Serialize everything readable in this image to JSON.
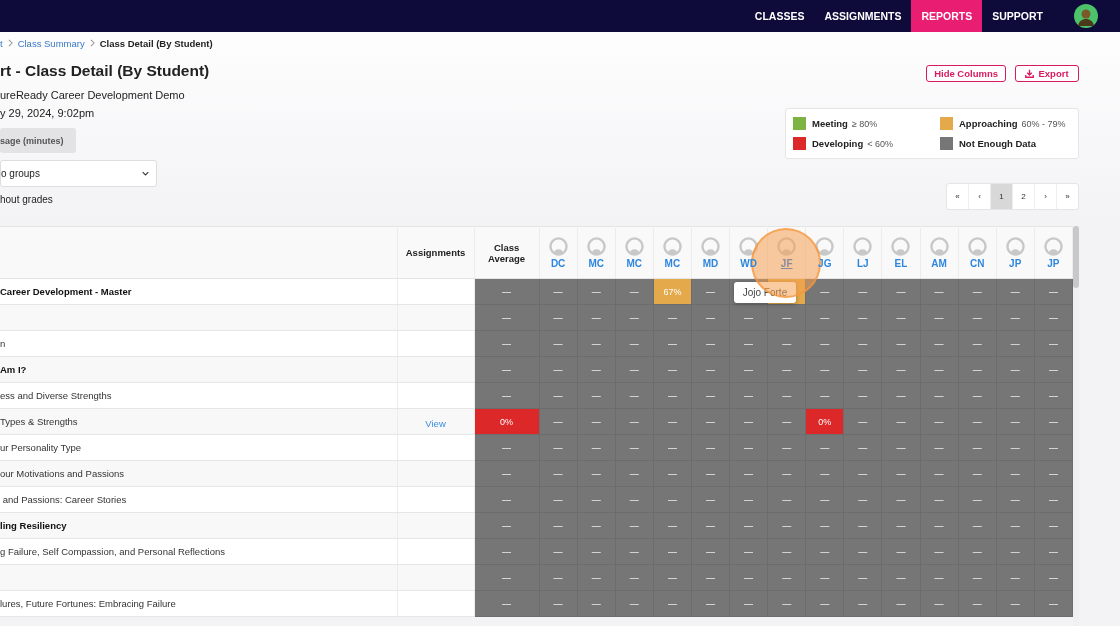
{
  "nav": {
    "items": [
      {
        "label": "CLASSES",
        "selected": false
      },
      {
        "label": "ASSIGNMENTS",
        "selected": false
      },
      {
        "label": "REPORTS",
        "selected": true
      },
      {
        "label": "SUPPORT",
        "selected": false
      }
    ]
  },
  "breadcrumb": [
    {
      "label": "t",
      "current": false
    },
    {
      "label": "Class Summary",
      "current": false
    },
    {
      "label": "Class Detail (By Student)",
      "current": true
    }
  ],
  "title": "rt - Class Detail (By Student)",
  "subtitle_lines": [
    "ureReady Career Development Demo",
    "y 29, 2024, 9:02pm"
  ],
  "usage_button": "sage (minutes)",
  "group_select": {
    "value": "o groups"
  },
  "grades_note": "hout grades",
  "actions": [
    {
      "label": "Hide Columns",
      "kind": "plain"
    },
    {
      "label": "Export",
      "kind": "download"
    }
  ],
  "legend": [
    {
      "label": "Meeting",
      "range": "≥ 80%",
      "color": "#7cb342"
    },
    {
      "label": "Approaching",
      "range": "60% - 79%",
      "color": "#e3a94b"
    },
    {
      "label": "Developing",
      "range": "< 60%",
      "color": "#dc2828"
    },
    {
      "label": "Not Enough Data",
      "color": "#767676"
    }
  ],
  "pagination": [
    {
      "label": "«",
      "selected": false
    },
    {
      "label": "‹",
      "selected": false
    },
    {
      "label": "1",
      "selected": true
    },
    {
      "label": "2",
      "selected": false
    },
    {
      "label": "›",
      "selected": false
    },
    {
      "label": "»",
      "selected": false
    }
  ],
  "table": {
    "columns": {
      "assignments": "Assignments",
      "class_average": "Class Average"
    },
    "students": [
      {
        "initials": "DC",
        "hovered": false
      },
      {
        "initials": "MC",
        "hovered": false
      },
      {
        "initials": "MC",
        "hovered": false
      },
      {
        "initials": "MC",
        "hovered": false
      },
      {
        "initials": "MD",
        "hovered": false
      },
      {
        "initials": "WD",
        "hovered": false
      },
      {
        "initials": "JF",
        "hovered": true,
        "tooltip": "Jojo Forte"
      },
      {
        "initials": "JG",
        "hovered": false
      },
      {
        "initials": "LJ",
        "hovered": false
      },
      {
        "initials": "EL",
        "hovered": false
      },
      {
        "initials": "AM",
        "hovered": false
      },
      {
        "initials": "CN",
        "hovered": false
      },
      {
        "initials": "JP",
        "hovered": false
      },
      {
        "initials": "JP",
        "hovered": false
      }
    ],
    "rows": [
      {
        "label": "Career Development - Master",
        "bold": true,
        "cells": [
          {
            "value": "—",
            "color": "#767676"
          },
          {
            "value": "—",
            "color": "#767676"
          },
          {
            "value": "—",
            "color": "#767676"
          },
          {
            "value": "—",
            "color": "#767676"
          },
          {
            "value": "67%",
            "color": "#e3a94b"
          },
          {
            "value": "—",
            "color": "#767676"
          },
          {
            "color": "#767676"
          },
          {
            "color": "#e3a94b"
          },
          {
            "value": "—",
            "color": "#767676"
          },
          {
            "value": "—",
            "color": "#767676"
          },
          {
            "value": "—",
            "color": "#767676"
          },
          {
            "value": "—",
            "color": "#767676"
          },
          {
            "value": "—",
            "color": "#767676"
          },
          {
            "value": "—",
            "color": "#767676"
          },
          {
            "value": "—",
            "color": "#767676"
          }
        ]
      },
      {
        "cells": [
          {
            "value": "—",
            "color": "#767676"
          },
          {
            "value": "—",
            "color": "#767676"
          },
          {
            "value": "—",
            "color": "#767676"
          },
          {
            "value": "—",
            "color": "#767676"
          },
          {
            "value": "—",
            "color": "#767676"
          },
          {
            "value": "—",
            "color": "#767676"
          },
          {
            "value": "—",
            "color": "#767676"
          },
          {
            "value": "—",
            "color": "#767676"
          },
          {
            "value": "—",
            "color": "#767676"
          },
          {
            "value": "—",
            "color": "#767676"
          },
          {
            "value": "—",
            "color": "#767676"
          },
          {
            "value": "—",
            "color": "#767676"
          },
          {
            "value": "—",
            "color": "#767676"
          },
          {
            "value": "—",
            "color": "#767676"
          },
          {
            "value": "—",
            "color": "#767676"
          }
        ]
      },
      {
        "label": "n",
        "bold": false,
        "cells": [
          {
            "value": "—",
            "color": "#767676"
          },
          {
            "value": "—",
            "color": "#767676"
          },
          {
            "value": "—",
            "color": "#767676"
          },
          {
            "value": "—",
            "color": "#767676"
          },
          {
            "value": "—",
            "color": "#767676"
          },
          {
            "value": "—",
            "color": "#767676"
          },
          {
            "value": "—",
            "color": "#767676"
          },
          {
            "value": "—",
            "color": "#767676"
          },
          {
            "value": "—",
            "color": "#767676"
          },
          {
            "value": "—",
            "color": "#767676"
          },
          {
            "value": "—",
            "color": "#767676"
          },
          {
            "value": "—",
            "color": "#767676"
          },
          {
            "value": "—",
            "color": "#767676"
          },
          {
            "value": "—",
            "color": "#767676"
          },
          {
            "value": "—",
            "color": "#767676"
          }
        ]
      },
      {
        "label": "Am I?",
        "bold": true,
        "cells": [
          {
            "value": "—",
            "color": "#767676"
          },
          {
            "value": "—",
            "color": "#767676"
          },
          {
            "value": "—",
            "color": "#767676"
          },
          {
            "value": "—",
            "color": "#767676"
          },
          {
            "value": "—",
            "color": "#767676"
          },
          {
            "value": "—",
            "color": "#767676"
          },
          {
            "value": "—",
            "color": "#767676"
          },
          {
            "value": "—",
            "color": "#767676"
          },
          {
            "value": "—",
            "color": "#767676"
          },
          {
            "value": "—",
            "color": "#767676"
          },
          {
            "value": "—",
            "color": "#767676"
          },
          {
            "value": "—",
            "color": "#767676"
          },
          {
            "value": "—",
            "color": "#767676"
          },
          {
            "value": "—",
            "color": "#767676"
          },
          {
            "value": "—",
            "color": "#767676"
          }
        ]
      },
      {
        "label": "ess and Diverse Strengths",
        "bold": false,
        "cells": [
          {
            "value": "—",
            "color": "#767676"
          },
          {
            "value": "—",
            "color": "#767676"
          },
          {
            "value": "—",
            "color": "#767676"
          },
          {
            "value": "—",
            "color": "#767676"
          },
          {
            "value": "—",
            "color": "#767676"
          },
          {
            "value": "—",
            "color": "#767676"
          },
          {
            "value": "—",
            "color": "#767676"
          },
          {
            "value": "—",
            "color": "#767676"
          },
          {
            "value": "—",
            "color": "#767676"
          },
          {
            "value": "—",
            "color": "#767676"
          },
          {
            "value": "—",
            "color": "#767676"
          },
          {
            "value": "—",
            "color": "#767676"
          },
          {
            "value": "—",
            "color": "#767676"
          },
          {
            "value": "—",
            "color": "#767676"
          },
          {
            "value": "—",
            "color": "#767676"
          }
        ]
      },
      {
        "label": "Types & Strengths",
        "bold": false,
        "assignment_link": "View",
        "cells": [
          {
            "value": "0%",
            "color": "#dc2828"
          },
          {
            "value": "—",
            "color": "#767676"
          },
          {
            "value": "—",
            "color": "#767676"
          },
          {
            "value": "—",
            "color": "#767676"
          },
          {
            "value": "—",
            "color": "#767676"
          },
          {
            "value": "—",
            "color": "#767676"
          },
          {
            "value": "—",
            "color": "#767676"
          },
          {
            "value": "—",
            "color": "#767676"
          },
          {
            "value": "0%",
            "color": "#dc2828"
          },
          {
            "value": "—",
            "color": "#767676"
          },
          {
            "value": "—",
            "color": "#767676"
          },
          {
            "value": "—",
            "color": "#767676"
          },
          {
            "value": "—",
            "color": "#767676"
          },
          {
            "value": "—",
            "color": "#767676"
          },
          {
            "value": "—",
            "color": "#767676"
          }
        ]
      },
      {
        "label": "ur Personality Type",
        "bold": false,
        "cells": [
          {
            "value": "—",
            "color": "#767676"
          },
          {
            "value": "—",
            "color": "#767676"
          },
          {
            "value": "—",
            "color": "#767676"
          },
          {
            "value": "—",
            "color": "#767676"
          },
          {
            "value": "—",
            "color": "#767676"
          },
          {
            "value": "—",
            "color": "#767676"
          },
          {
            "value": "—",
            "color": "#767676"
          },
          {
            "value": "—",
            "color": "#767676"
          },
          {
            "value": "—",
            "color": "#767676"
          },
          {
            "value": "—",
            "color": "#767676"
          },
          {
            "value": "—",
            "color": "#767676"
          },
          {
            "value": "—",
            "color": "#767676"
          },
          {
            "value": "—",
            "color": "#767676"
          },
          {
            "value": "—",
            "color": "#767676"
          },
          {
            "value": "—",
            "color": "#767676"
          }
        ]
      },
      {
        "label": "our Motivations and Passions",
        "bold": false,
        "cells": [
          {
            "value": "—",
            "color": "#767676"
          },
          {
            "value": "—",
            "color": "#767676"
          },
          {
            "value": "—",
            "color": "#767676"
          },
          {
            "value": "—",
            "color": "#767676"
          },
          {
            "value": "—",
            "color": "#767676"
          },
          {
            "value": "—",
            "color": "#767676"
          },
          {
            "value": "—",
            "color": "#767676"
          },
          {
            "value": "—",
            "color": "#767676"
          },
          {
            "value": "—",
            "color": "#767676"
          },
          {
            "value": "—",
            "color": "#767676"
          },
          {
            "value": "—",
            "color": "#767676"
          },
          {
            "value": "—",
            "color": "#767676"
          },
          {
            "value": "—",
            "color": "#767676"
          },
          {
            "value": "—",
            "color": "#767676"
          },
          {
            "value": "—",
            "color": "#767676"
          }
        ]
      },
      {
        "label": " and Passions: Career Stories",
        "bold": false,
        "cells": [
          {
            "value": "—",
            "color": "#767676"
          },
          {
            "value": "—",
            "color": "#767676"
          },
          {
            "value": "—",
            "color": "#767676"
          },
          {
            "value": "—",
            "color": "#767676"
          },
          {
            "value": "—",
            "color": "#767676"
          },
          {
            "value": "—",
            "color": "#767676"
          },
          {
            "value": "—",
            "color": "#767676"
          },
          {
            "value": "—",
            "color": "#767676"
          },
          {
            "value": "—",
            "color": "#767676"
          },
          {
            "value": "—",
            "color": "#767676"
          },
          {
            "value": "—",
            "color": "#767676"
          },
          {
            "value": "—",
            "color": "#767676"
          },
          {
            "value": "—",
            "color": "#767676"
          },
          {
            "value": "—",
            "color": "#767676"
          },
          {
            "value": "—",
            "color": "#767676"
          }
        ]
      },
      {
        "label": "ling Resiliency",
        "bold": true,
        "cells": [
          {
            "value": "—",
            "color": "#767676"
          },
          {
            "value": "—",
            "color": "#767676"
          },
          {
            "value": "—",
            "color": "#767676"
          },
          {
            "value": "—",
            "color": "#767676"
          },
          {
            "value": "—",
            "color": "#767676"
          },
          {
            "value": "—",
            "color": "#767676"
          },
          {
            "value": "—",
            "color": "#767676"
          },
          {
            "value": "—",
            "color": "#767676"
          },
          {
            "value": "—",
            "color": "#767676"
          },
          {
            "value": "—",
            "color": "#767676"
          },
          {
            "value": "—",
            "color": "#767676"
          },
          {
            "value": "—",
            "color": "#767676"
          },
          {
            "value": "—",
            "color": "#767676"
          },
          {
            "value": "—",
            "color": "#767676"
          },
          {
            "value": "—",
            "color": "#767676"
          }
        ]
      },
      {
        "label": "g Failure, Self Compassion, and Personal Reflections",
        "bold": false,
        "cells": [
          {
            "value": "—",
            "color": "#767676"
          },
          {
            "value": "—",
            "color": "#767676"
          },
          {
            "value": "—",
            "color": "#767676"
          },
          {
            "value": "—",
            "color": "#767676"
          },
          {
            "value": "—",
            "color": "#767676"
          },
          {
            "value": "—",
            "color": "#767676"
          },
          {
            "value": "—",
            "color": "#767676"
          },
          {
            "value": "—",
            "color": "#767676"
          },
          {
            "value": "—",
            "color": "#767676"
          },
          {
            "value": "—",
            "color": "#767676"
          },
          {
            "value": "—",
            "color": "#767676"
          },
          {
            "value": "—",
            "color": "#767676"
          },
          {
            "value": "—",
            "color": "#767676"
          },
          {
            "value": "—",
            "color": "#767676"
          },
          {
            "value": "—",
            "color": "#767676"
          }
        ]
      },
      {
        "cells": [
          {
            "value": "—",
            "color": "#767676"
          },
          {
            "value": "—",
            "color": "#767676"
          },
          {
            "value": "—",
            "color": "#767676"
          },
          {
            "value": "—",
            "color": "#767676"
          },
          {
            "value": "—",
            "color": "#767676"
          },
          {
            "value": "—",
            "color": "#767676"
          },
          {
            "value": "—",
            "color": "#767676"
          },
          {
            "value": "—",
            "color": "#767676"
          },
          {
            "value": "—",
            "color": "#767676"
          },
          {
            "value": "—",
            "color": "#767676"
          },
          {
            "value": "—",
            "color": "#767676"
          },
          {
            "value": "—",
            "color": "#767676"
          },
          {
            "value": "—",
            "color": "#767676"
          },
          {
            "value": "—",
            "color": "#767676"
          },
          {
            "value": "—",
            "color": "#767676"
          }
        ]
      },
      {
        "label": "lures, Future Fortunes: Embracing Failure",
        "bold": false,
        "cells": [
          {
            "value": "—",
            "color": "#767676"
          },
          {
            "value": "—",
            "color": "#767676"
          },
          {
            "value": "—",
            "color": "#767676"
          },
          {
            "value": "—",
            "color": "#767676"
          },
          {
            "value": "—",
            "color": "#767676"
          },
          {
            "value": "—",
            "color": "#767676"
          },
          {
            "value": "—",
            "color": "#767676"
          },
          {
            "value": "—",
            "color": "#767676"
          },
          {
            "value": "—",
            "color": "#767676"
          },
          {
            "value": "—",
            "color": "#767676"
          },
          {
            "value": "—",
            "color": "#767676"
          },
          {
            "value": "—",
            "color": "#767676"
          },
          {
            "value": "—",
            "color": "#767676"
          },
          {
            "value": "—",
            "color": "#767676"
          },
          {
            "value": "—",
            "color": "#767676"
          }
        ]
      }
    ]
  }
}
